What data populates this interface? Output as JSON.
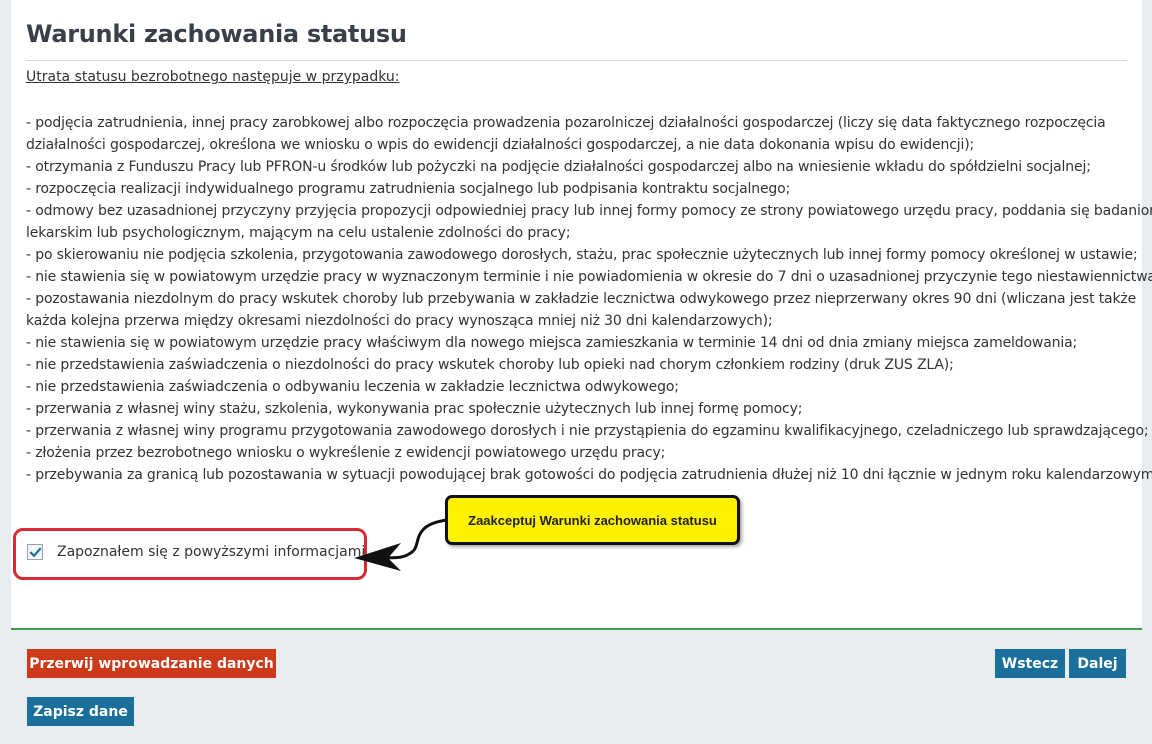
{
  "page": {
    "title": "Warunki zachowania statusu",
    "intro": "Utrata statusu bezrobotnego następuje w przypadku:"
  },
  "conditions": [
    "- podjęcia zatrudnienia, innej pracy zarobkowej albo rozpoczęcia prowadzenia pozarolniczej działalności gospodarczej (liczy się data faktycznego rozpoczęcia",
    "działalności gospodarczej, określona we wniosku o wpis do ewidencji działalności gospodarczej, a nie data dokonania wpisu do ewidencji);",
    "- otrzymania z Funduszu Pracy lub PFRON-u środków lub pożyczki na podjęcie działalności gospodarczej albo na wniesienie wkładu do spółdzielni socjalnej;",
    "- rozpoczęcia realizacji indywidualnego programu zatrudnienia socjalnego lub podpisania kontraktu socjalnego;",
    "- odmowy bez uzasadnionej przyczyny przyjęcia propozycji odpowiedniej pracy lub innej formy pomocy ze strony powiatowego urzędu pracy, poddania się badaniom",
    "lekarskim lub psychologicznym, mającym na celu ustalenie zdolności do pracy;",
    "- po skierowaniu nie podjęcia szkolenia, przygotowania zawodowego dorosłych, stażu, prac społecznie użytecznych lub innej formy pomocy określonej w ustawie;",
    "- nie stawienia się w powiatowym urzędzie pracy w wyznaczonym terminie i nie powiadomienia w okresie do 7 dni o uzasadnionej przyczynie tego niestawiennictwa;",
    "- pozostawania niezdolnym do pracy wskutek choroby lub przebywania w zakładzie lecznictwa odwykowego przez nieprzerwany okres 90 dni (wliczana jest także",
    "każda kolejna przerwa między okresami niezdolności do pracy wynosząca mniej niż 30 dni kalendarzowych);",
    "- nie stawienia się w powiatowym urzędzie pracy właściwym dla nowego miejsca zamieszkania w terminie 14 dni od dnia zmiany miejsca zameldowania;",
    "- nie przedstawienia zaświadczenia o niezdolności do pracy wskutek choroby lub opieki nad chorym członkiem rodziny (druk ZUS ZLA);",
    "- nie przedstawienia zaświadczenia o odbywaniu leczenia w zakładzie lecznictwa odwykowego;",
    "- przerwania z własnej winy stażu, szkolenia, wykonywania prac społecznie użytecznych lub innej formę pomocy;",
    "- przerwania z własnej winy programu przygotowania zawodowego dorosłych i nie przystąpienia do egzaminu kwalifikacyjnego, czeladniczego lub sprawdzającego;",
    "- złożenia przez bezrobotnego wniosku o wykreślenie z ewidencji powiatowego urzędu pracy;",
    "- przebywania za granicą lub pozostawania w sytuacji powodującej brak gotowości do podjęcia zatrudnienia dłużej niż 10 dni łącznie w jednym roku kalendarzowym."
  ],
  "acknowledgement": {
    "label": "Zapoznałem się z powyższymi informacjami",
    "checked": true
  },
  "callout": {
    "text": "Zaakceptuj Warunki zachowania statusu"
  },
  "buttons": {
    "cancel": "Przerwij wprowadzanie danych",
    "back": "Wstecz",
    "next": "Dalej",
    "save": "Zapisz dane"
  },
  "colors": {
    "cancel_button": "#cc3a1a",
    "primary_button": "#1a6f9b",
    "highlight_border": "#d62b35",
    "callout_fill": "#fff200",
    "separator": "#3f9a4a"
  }
}
